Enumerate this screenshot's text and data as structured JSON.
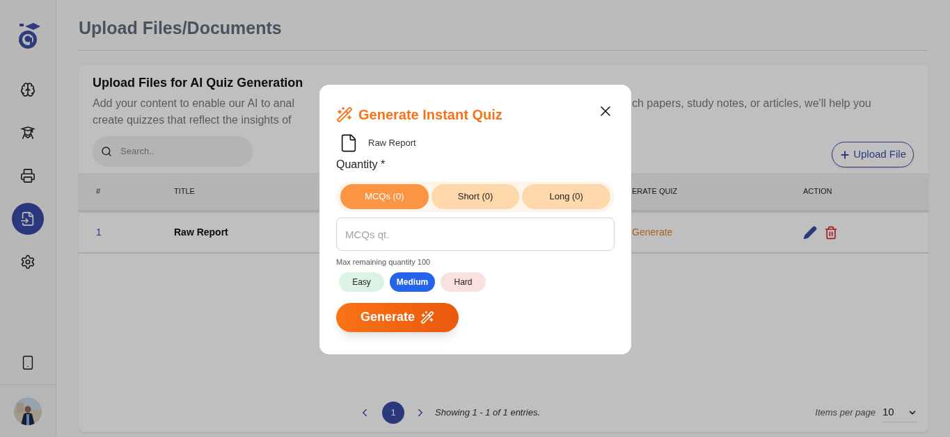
{
  "sidebar": {
    "items": [
      {
        "kind": "brain",
        "selected": false
      },
      {
        "kind": "student",
        "selected": false
      },
      {
        "kind": "printer",
        "selected": false
      },
      {
        "kind": "file-import",
        "selected": true
      },
      {
        "kind": "settings",
        "selected": false
      }
    ]
  },
  "page": {
    "title": "Upload Files/Documents"
  },
  "card": {
    "title": "Upload Files for AI Quiz Generation",
    "description_left": [
      "Add your content to enable our AI to anal",
      "create quizzes that reflect the insights of"
    ],
    "description_right": [
      "ch papers, study notes, or articles, we'll help you"
    ],
    "search": {
      "placeholder": "Search.."
    },
    "upload_button": "Upload File"
  },
  "table": {
    "columns": [
      "#",
      "TITLE",
      "ERATE QUIZ",
      "ACTION"
    ],
    "rows": [
      {
        "number": "1",
        "title": "Raw Report",
        "generate": "Generate"
      }
    ]
  },
  "pagination": {
    "pages": [
      {
        "label": "1",
        "selected": true
      }
    ],
    "summary": "Showing 1 - 1 of 1 entries.",
    "items_per_page_label": "Items per page",
    "items_per_page": "10"
  },
  "modal": {
    "title": "Generate Instant Quiz",
    "file_name": "Raw Report",
    "quantity_label": "Quantity *",
    "tabs": [
      {
        "label": "MCQs (0)",
        "selected": true
      },
      {
        "label": "Short (0)",
        "selected": false
      },
      {
        "label": "Long (0)",
        "selected": false
      }
    ],
    "quantity_field": {
      "placeholder": "MCQs qt."
    },
    "hint": "Max remaining quantity 100",
    "difficulties": [
      {
        "label": "Easy",
        "selected": false,
        "color": "#dcf2e4"
      },
      {
        "label": "Medium",
        "selected": true,
        "color": "#2563eb"
      },
      {
        "label": "Hard",
        "selected": false,
        "color": "#fbe0e0"
      }
    ],
    "generate_button": "Generate"
  }
}
